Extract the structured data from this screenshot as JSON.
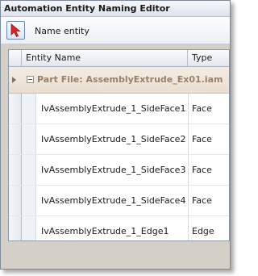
{
  "window": {
    "title": "Automation Entity Naming Editor"
  },
  "toolbar": {
    "name_entity_label": "Name entity",
    "tool_icon": "select-arrow-icon"
  },
  "grid": {
    "columns": [
      "Entity Name",
      "Type"
    ],
    "group": {
      "label": "Part File: AssemblyExtrude_Ex01.iam"
    },
    "rows": [
      {
        "name": "IvAssemblyExtrude_1_SideFace1",
        "type": "Face"
      },
      {
        "name": "IvAssemblyExtrude_1_SideFace2",
        "type": "Face"
      },
      {
        "name": "IvAssemblyExtrude_1_SideFace3",
        "type": "Face"
      },
      {
        "name": "IvAssemblyExtrude_1_SideFace4",
        "type": "Face"
      },
      {
        "name": "IvAssemblyExtrude_1_Edge1",
        "type": "Edge"
      }
    ]
  }
}
